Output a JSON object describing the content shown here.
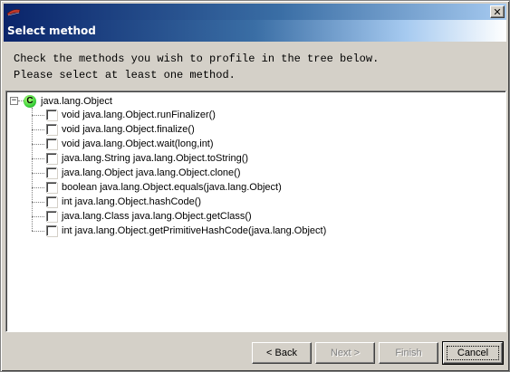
{
  "window": {
    "header_title": "Select method",
    "close_glyph": "✕"
  },
  "instructions": {
    "line1": "Check the methods you wish to profile in the tree below.",
    "line2": "Please select at least one method."
  },
  "tree": {
    "root": {
      "icon_letter": "C",
      "label": "java.lang.Object",
      "expander": "−"
    },
    "methods": [
      {
        "label": "void java.lang.Object.runFinalizer()",
        "checked": false
      },
      {
        "label": "void java.lang.Object.finalize()",
        "checked": false
      },
      {
        "label": "void java.lang.Object.wait(long,int)",
        "checked": false
      },
      {
        "label": "java.lang.String java.lang.Object.toString()",
        "checked": false
      },
      {
        "label": "java.lang.Object java.lang.Object.clone()",
        "checked": false
      },
      {
        "label": "boolean java.lang.Object.equals(java.lang.Object)",
        "checked": false
      },
      {
        "label": "int java.lang.Object.hashCode()",
        "checked": false
      },
      {
        "label": "java.lang.Class java.lang.Object.getClass()",
        "checked": false
      },
      {
        "label": "int java.lang.Object.getPrimitiveHashCode(java.lang.Object)",
        "checked": false
      }
    ]
  },
  "buttons": {
    "back": "< Back",
    "next": "Next >",
    "finish": "Finish",
    "cancel": "Cancel"
  },
  "colors": {
    "class_icon": "#3cd23c",
    "titlebar_start": "#0a246a",
    "titlebar_end": "#a6caf0"
  }
}
